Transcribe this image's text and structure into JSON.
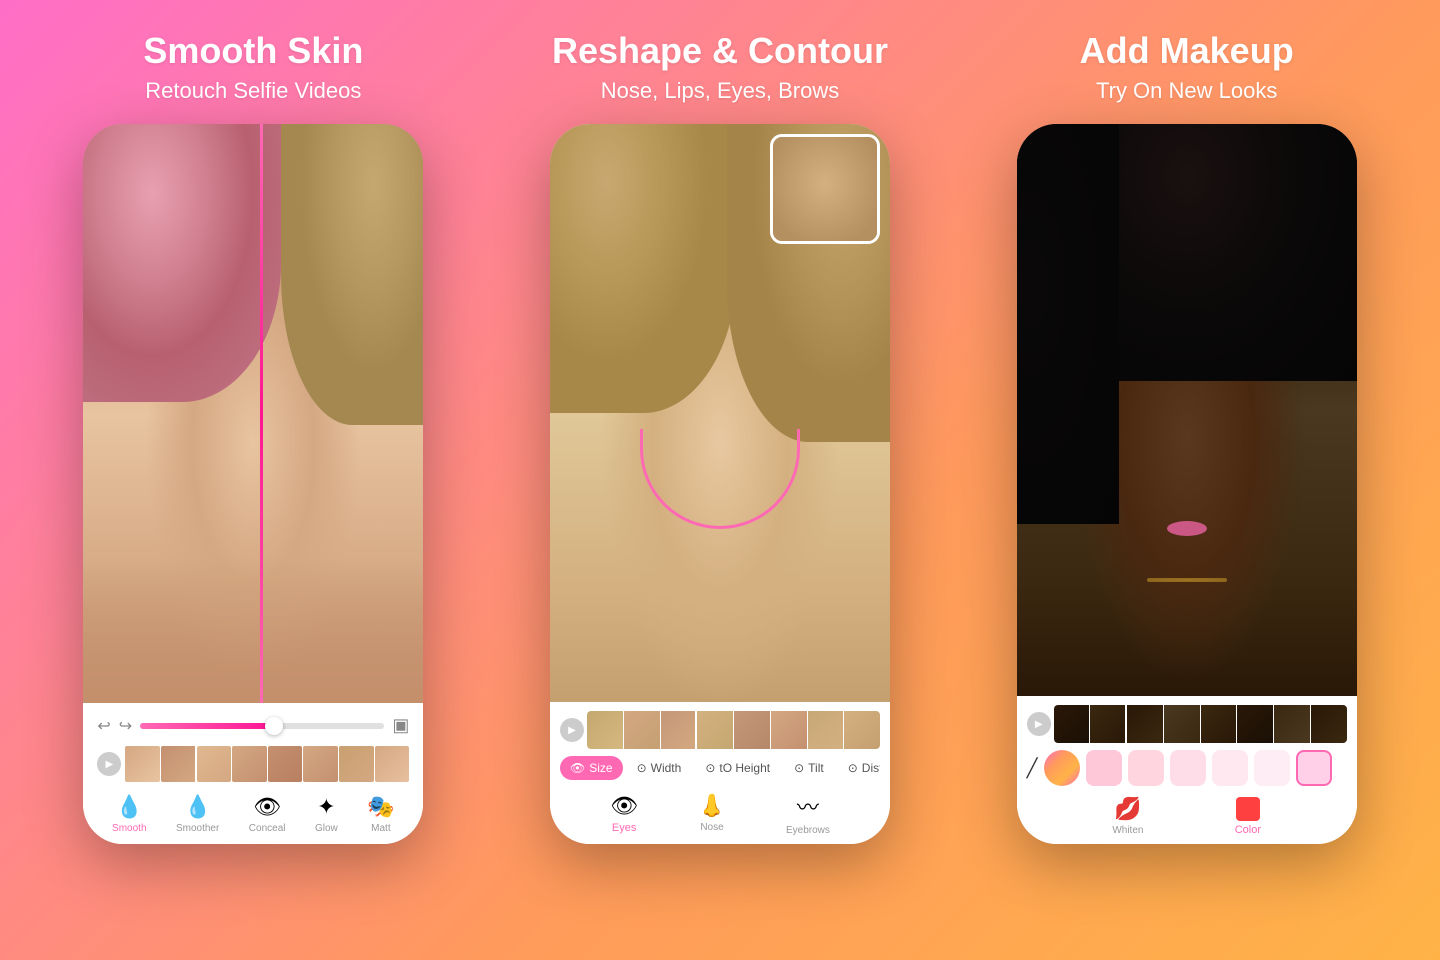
{
  "panels": [
    {
      "id": "smooth-skin",
      "title": "Smooth Skin",
      "subtitle": "Retouch Selfie Videos",
      "tools": [
        {
          "label": "Smooth",
          "icon": "💧",
          "active": true
        },
        {
          "label": "Smoother",
          "icon": "💧",
          "active": false
        },
        {
          "label": "Conceal",
          "icon": "👁",
          "active": false
        },
        {
          "label": "Glow",
          "icon": "✨",
          "active": false
        },
        {
          "label": "Matt",
          "icon": "🎭",
          "active": false
        }
      ]
    },
    {
      "id": "reshape-contour",
      "title": "Reshape & Contour",
      "subtitle": "Nose, Lips, Eyes, Brows",
      "tabs": [
        {
          "label": "Size",
          "icon": "👁",
          "active": true
        },
        {
          "label": "Width",
          "icon": "⊙",
          "active": false
        },
        {
          "label": "tO Height",
          "icon": "⊙",
          "active": false
        },
        {
          "label": "Tilt",
          "icon": "⊙",
          "active": false
        },
        {
          "label": "Dist",
          "icon": "⊙",
          "active": false
        }
      ],
      "tools": [
        {
          "label": "Eyes",
          "icon": "👁",
          "active": true
        },
        {
          "label": "Nose",
          "icon": "👃",
          "active": false
        },
        {
          "label": "Eyebrows",
          "icon": "〰",
          "active": false
        }
      ]
    },
    {
      "id": "add-makeup",
      "title": "Add Makeup",
      "subtitle": "Try On New Looks",
      "colors": [
        "#ff69b4",
        "#ffb3d1",
        "#ffc8d8",
        "#ffd5e0",
        "#ffe0ea",
        "#ffeaf2"
      ],
      "tools": [
        {
          "label": "Whiten",
          "icon": "💋",
          "active": false
        },
        {
          "label": "Color",
          "icon": "🟥",
          "active": true
        }
      ]
    }
  ],
  "icons": {
    "undo": "↩",
    "redo": "↪",
    "play": "▶",
    "compare": "⬛"
  }
}
